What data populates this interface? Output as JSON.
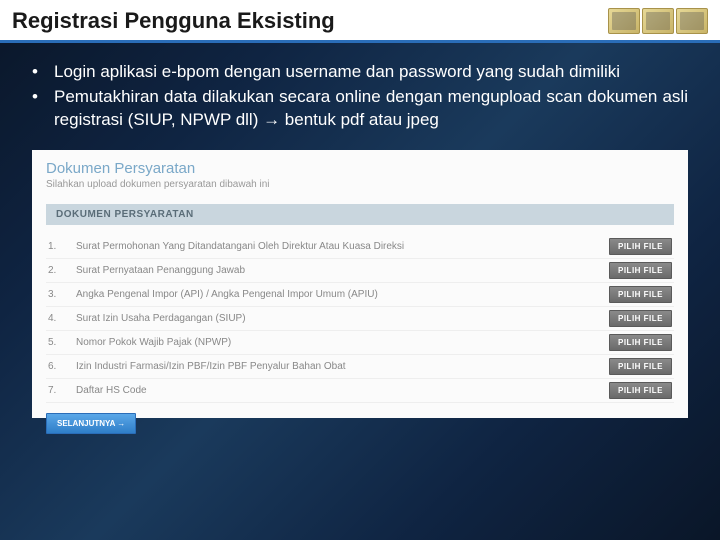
{
  "title": "Registrasi Pengguna Eksisting",
  "bullets": [
    "Login aplikasi e-bpom dengan username dan password yang sudah dimiliki",
    "Pemutakhiran data dilakukan secara online dengan mengupload scan dokumen  asli registrasi (SIUP, NPWP dll) → bentuk pdf atau jpeg"
  ],
  "panel": {
    "title": "Dokumen Persyaratan",
    "subtitle": "Silahkan upload dokumen persyaratan dibawah ini",
    "section_header": "DOKUMEN PERSYARATAN",
    "file_button": "PILIH FILE",
    "next_button": "SELANJUTNYA →",
    "items": [
      {
        "num": "1.",
        "label": "Surat Permohonan Yang Ditandatangani Oleh Direktur Atau Kuasa Direksi"
      },
      {
        "num": "2.",
        "label": "Surat Pernyataan Penanggung Jawab"
      },
      {
        "num": "3.",
        "label": "Angka Pengenal Impor (API) / Angka Pengenal Impor Umum (APIU)"
      },
      {
        "num": "4.",
        "label": "Surat Izin Usaha Perdagangan (SIUP)"
      },
      {
        "num": "5.",
        "label": "Nomor Pokok Wajib Pajak (NPWP)"
      },
      {
        "num": "6.",
        "label": "Izin Industri Farmasi/Izin PBF/Izin PBF Penyalur Bahan Obat"
      },
      {
        "num": "7.",
        "label": "Daftar HS Code"
      }
    ]
  }
}
